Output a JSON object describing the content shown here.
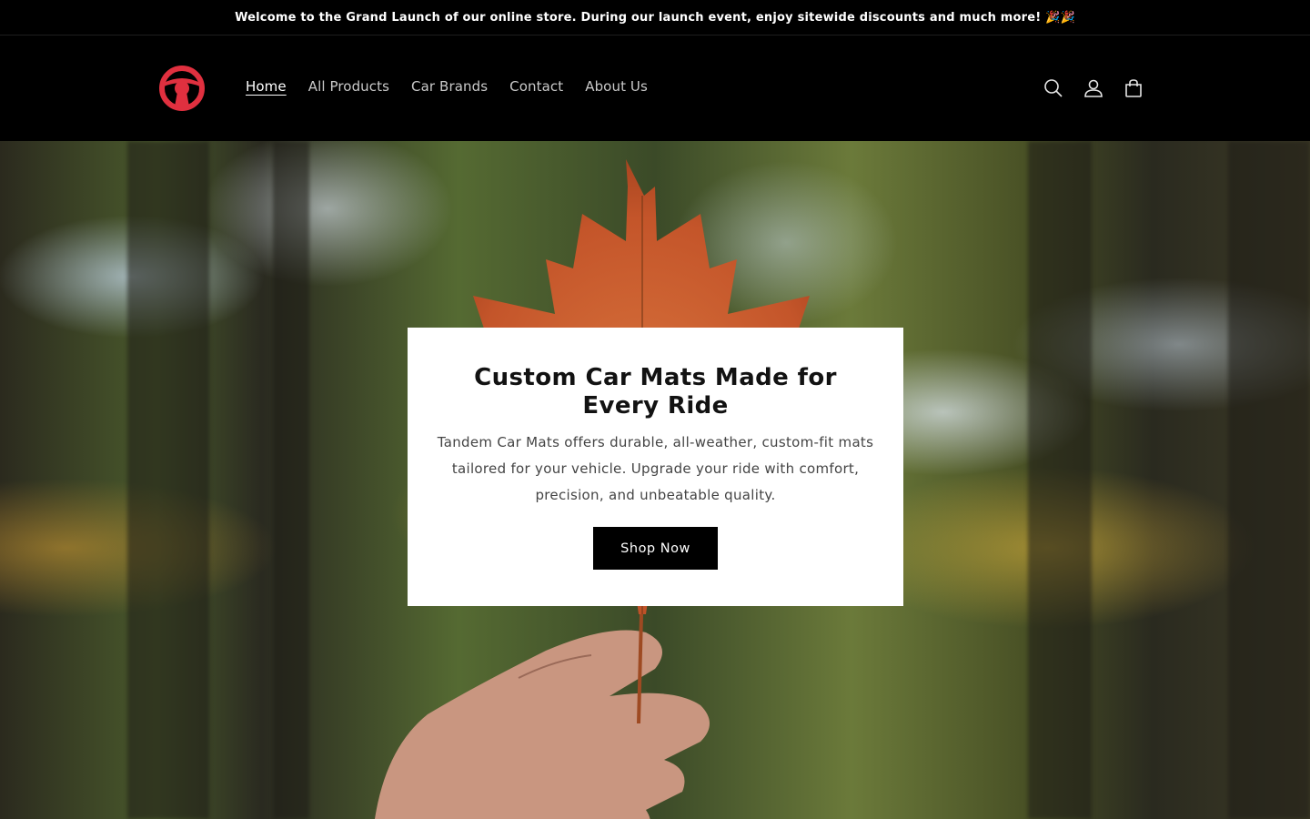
{
  "announcement": {
    "text": "Welcome to the Grand Launch of our online store. During our launch event, enjoy sitewide discounts and much more! 🎉🎉"
  },
  "header": {
    "logo_icon": "steering-wheel-icon",
    "nav": [
      {
        "label": "Home",
        "active": true
      },
      {
        "label": "All Products",
        "active": false
      },
      {
        "label": "Car Brands",
        "active": false
      },
      {
        "label": "Contact",
        "active": false
      },
      {
        "label": "About Us",
        "active": false
      }
    ],
    "icons": [
      "search-icon",
      "account-icon",
      "cart-icon"
    ]
  },
  "hero": {
    "title": "Custom Car Mats Made for Every Ride",
    "text": "Tandem Car Mats offers durable, all-weather, custom-fit mats tailored for your vehicle. Upgrade your ride with comfort, precision, and unbeatable quality.",
    "button_label": "Shop Now"
  },
  "colors": {
    "brand_red": "#e0303f",
    "header_bg": "#000000",
    "card_bg": "#ffffff"
  }
}
